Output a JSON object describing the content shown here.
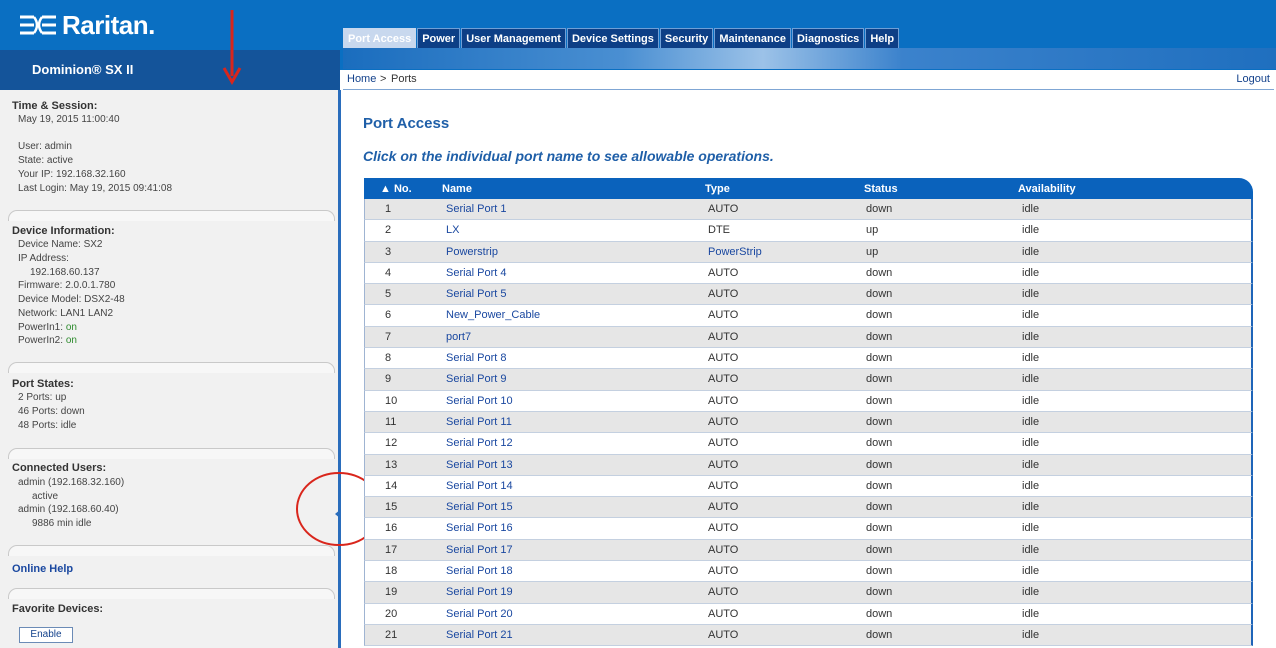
{
  "brand": {
    "logo_text": "Raritan.",
    "product": "Dominion® SX II"
  },
  "nav": {
    "tabs": [
      {
        "label": "Port Access",
        "active": true
      },
      {
        "label": "Power",
        "active": false
      },
      {
        "label": "User Management",
        "active": false
      },
      {
        "label": "Device Settings",
        "active": false
      },
      {
        "label": "Security",
        "active": false
      },
      {
        "label": "Maintenance",
        "active": false
      },
      {
        "label": "Diagnostics",
        "active": false
      },
      {
        "label": "Help",
        "active": false
      }
    ]
  },
  "breadcrumb": {
    "home": "Home",
    "separator": ">",
    "current": "Ports"
  },
  "logout": "Logout",
  "sidebar": {
    "time_session": {
      "title": "Time & Session:",
      "datetime": "May 19, 2015 11:00:40",
      "user": "User: admin",
      "state": "State: active",
      "ip": "Your IP: 192.168.32.160",
      "last_login": "Last Login: May 19, 2015 09:41:08"
    },
    "device_info": {
      "title": "Device Information:",
      "name": "Device Name: SX2",
      "ip_label": "IP Address:",
      "ip_value": "192.168.60.137",
      "firmware": "Firmware: 2.0.0.1.780",
      "model": "Device Model: DSX2-48",
      "network": "Network: LAN1 LAN2",
      "powerin1_label": "PowerIn1:",
      "powerin1_value": "on",
      "powerin2_label": "PowerIn2:",
      "powerin2_value": "on"
    },
    "port_states": {
      "title": "Port States:",
      "up": "2 Ports: up",
      "down": "46 Ports: down",
      "idle": "48 Ports: idle"
    },
    "connected_users": {
      "title": "Connected Users:",
      "user1": "admin (192.168.32.160)",
      "user1_state": "active",
      "user2": "admin (192.168.60.40)",
      "user2_state": "9886 min idle"
    },
    "online_help": "Online Help",
    "favorites": {
      "title": "Favorite Devices:",
      "button": "Enable"
    }
  },
  "main": {
    "title": "Port Access",
    "subtitle": "Click on the individual port name to see allowable operations.",
    "table": {
      "headers": {
        "no": "▲ No.",
        "name": "Name",
        "type": "Type",
        "status": "Status",
        "availability": "Availability"
      },
      "rows": [
        {
          "no": "1",
          "name": "Serial Port 1",
          "type": "AUTO",
          "status": "down",
          "avail": "idle"
        },
        {
          "no": "2",
          "name": "LX",
          "type": "DTE",
          "status": "up",
          "avail": "idle"
        },
        {
          "no": "3",
          "name": "Powerstrip",
          "type": "PowerStrip",
          "status": "up",
          "avail": "idle"
        },
        {
          "no": "4",
          "name": "Serial Port 4",
          "type": "AUTO",
          "status": "down",
          "avail": "idle"
        },
        {
          "no": "5",
          "name": "Serial Port 5",
          "type": "AUTO",
          "status": "down",
          "avail": "idle"
        },
        {
          "no": "6",
          "name": "New_Power_Cable",
          "type": "AUTO",
          "status": "down",
          "avail": "idle"
        },
        {
          "no": "7",
          "name": "port7",
          "type": "AUTO",
          "status": "down",
          "avail": "idle"
        },
        {
          "no": "8",
          "name": "Serial Port 8",
          "type": "AUTO",
          "status": "down",
          "avail": "idle"
        },
        {
          "no": "9",
          "name": "Serial Port 9",
          "type": "AUTO",
          "status": "down",
          "avail": "idle"
        },
        {
          "no": "10",
          "name": "Serial Port 10",
          "type": "AUTO",
          "status": "down",
          "avail": "idle"
        },
        {
          "no": "11",
          "name": "Serial Port 11",
          "type": "AUTO",
          "status": "down",
          "avail": "idle"
        },
        {
          "no": "12",
          "name": "Serial Port 12",
          "type": "AUTO",
          "status": "down",
          "avail": "idle"
        },
        {
          "no": "13",
          "name": "Serial Port 13",
          "type": "AUTO",
          "status": "down",
          "avail": "idle"
        },
        {
          "no": "14",
          "name": "Serial Port 14",
          "type": "AUTO",
          "status": "down",
          "avail": "idle"
        },
        {
          "no": "15",
          "name": "Serial Port 15",
          "type": "AUTO",
          "status": "down",
          "avail": "idle"
        },
        {
          "no": "16",
          "name": "Serial Port 16",
          "type": "AUTO",
          "status": "down",
          "avail": "idle"
        },
        {
          "no": "17",
          "name": "Serial Port 17",
          "type": "AUTO",
          "status": "down",
          "avail": "idle"
        },
        {
          "no": "18",
          "name": "Serial Port 18",
          "type": "AUTO",
          "status": "down",
          "avail": "idle"
        },
        {
          "no": "19",
          "name": "Serial Port 19",
          "type": "AUTO",
          "status": "down",
          "avail": "idle"
        },
        {
          "no": "20",
          "name": "Serial Port 20",
          "type": "AUTO",
          "status": "down",
          "avail": "idle"
        },
        {
          "no": "21",
          "name": "Serial Port 21",
          "type": "AUTO",
          "status": "down",
          "avail": "idle"
        }
      ]
    }
  },
  "colors": {
    "header_blue": "#0a6fc2",
    "nav_dark": "#0d3f86",
    "link": "#1a48a0",
    "title_blue": "#1f5fa8",
    "annotation_red": "#d9261c"
  }
}
